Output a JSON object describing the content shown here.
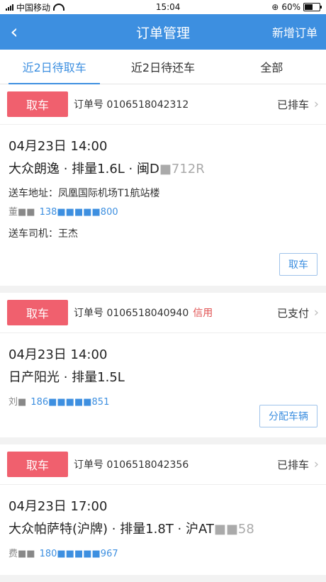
{
  "status_bar": {
    "carrier": "中国移动",
    "time": "15:04",
    "battery": "60%",
    "battery_level": 0.6
  },
  "nav": {
    "back_icon": "chevron-left-icon",
    "title": "订单管理",
    "action": "新增订单"
  },
  "tabs": [
    {
      "label": "近2日待取车",
      "active": true
    },
    {
      "label": "近2日待还车",
      "active": false
    },
    {
      "label": "全部",
      "active": false
    }
  ],
  "orders": [
    {
      "badge": "取车",
      "order_no": "订单号 0106518042312",
      "credit": "",
      "status": "已排车",
      "time": "04月23日 14:00",
      "car": "大众朗逸 · 排量1.6L · 闽D",
      "plate_blur": "■712R",
      "address": "送车地址：凤凰国际机场T1航站楼",
      "contact_name": "董■■",
      "phone": "138■■■■■800",
      "driver": "送车司机：王杰",
      "button": "取车"
    },
    {
      "badge": "取车",
      "order_no": "订单号 0106518040940",
      "credit": "信用",
      "status": "已支付",
      "time": "04月23日 14:00",
      "car": "日产阳光 · 排量1.5L",
      "contact_name": "刘■",
      "phone": "186■■■■■851",
      "button": "分配车辆"
    },
    {
      "badge": "取车",
      "order_no": "订单号 0106518042356",
      "credit": "",
      "status": "已排车",
      "time": "04月23日 17:00",
      "car": "大众帕萨特(沪牌) · 排量1.8T · 沪AT",
      "plate_blur": "■■58",
      "contact_name": "费■■",
      "phone": "180■■■■■967"
    }
  ]
}
